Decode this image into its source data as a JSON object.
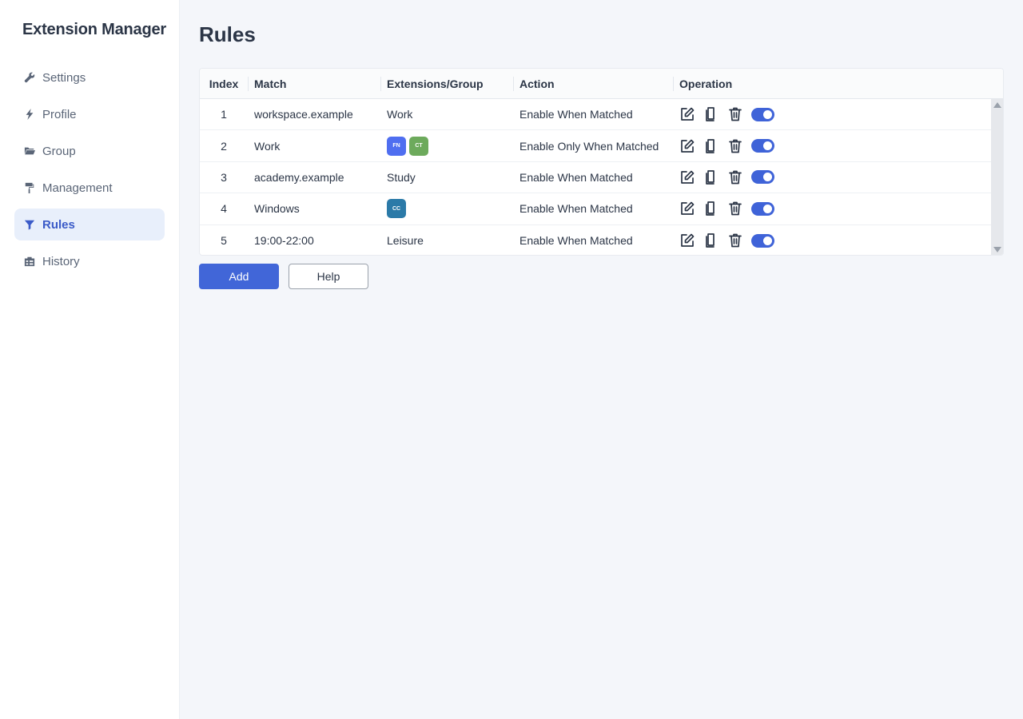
{
  "app": {
    "title": "Extension Manager"
  },
  "sidebar": {
    "items": [
      {
        "label": "Settings",
        "icon": "wrench-icon",
        "active": false
      },
      {
        "label": "Profile",
        "icon": "bolt-icon",
        "active": false
      },
      {
        "label": "Group",
        "icon": "folder-icon",
        "active": false
      },
      {
        "label": "Management",
        "icon": "paint-roller-icon",
        "active": false
      },
      {
        "label": "Rules",
        "icon": "filter-icon",
        "active": true
      },
      {
        "label": "History",
        "icon": "history-icon",
        "active": false
      }
    ]
  },
  "page": {
    "title": "Rules"
  },
  "table": {
    "headers": {
      "index": "Index",
      "match": "Match",
      "extensions": "Extensions/Group",
      "action": "Action",
      "operation": "Operation"
    },
    "rows": [
      {
        "index": "1",
        "match": "workspace.example",
        "group": "Work",
        "badges": [],
        "action": "Enable When Matched",
        "enabled": true
      },
      {
        "index": "2",
        "match": "Work",
        "group": "",
        "badges": [
          {
            "text": "FN",
            "color": "#4f6ef0"
          },
          {
            "text": "CT",
            "color": "#6daa5c"
          }
        ],
        "action": "Enable Only When Matched",
        "enabled": true
      },
      {
        "index": "3",
        "match": "academy.example",
        "group": "Study",
        "badges": [],
        "action": "Enable When Matched",
        "enabled": true
      },
      {
        "index": "4",
        "match": "Windows",
        "group": "",
        "badges": [
          {
            "text": "CC",
            "color": "#2b7aa8"
          }
        ],
        "action": "Enable When Matched",
        "enabled": true
      },
      {
        "index": "5",
        "match": "19:00-22:00",
        "group": "Leisure",
        "badges": [],
        "action": "Enable When Matched",
        "enabled": true
      }
    ]
  },
  "buttons": {
    "add": "Add",
    "help": "Help"
  },
  "colors": {
    "accent": "#4166d8",
    "active_nav_bg": "#e8effb",
    "toggle_on": "#3f63d8"
  }
}
